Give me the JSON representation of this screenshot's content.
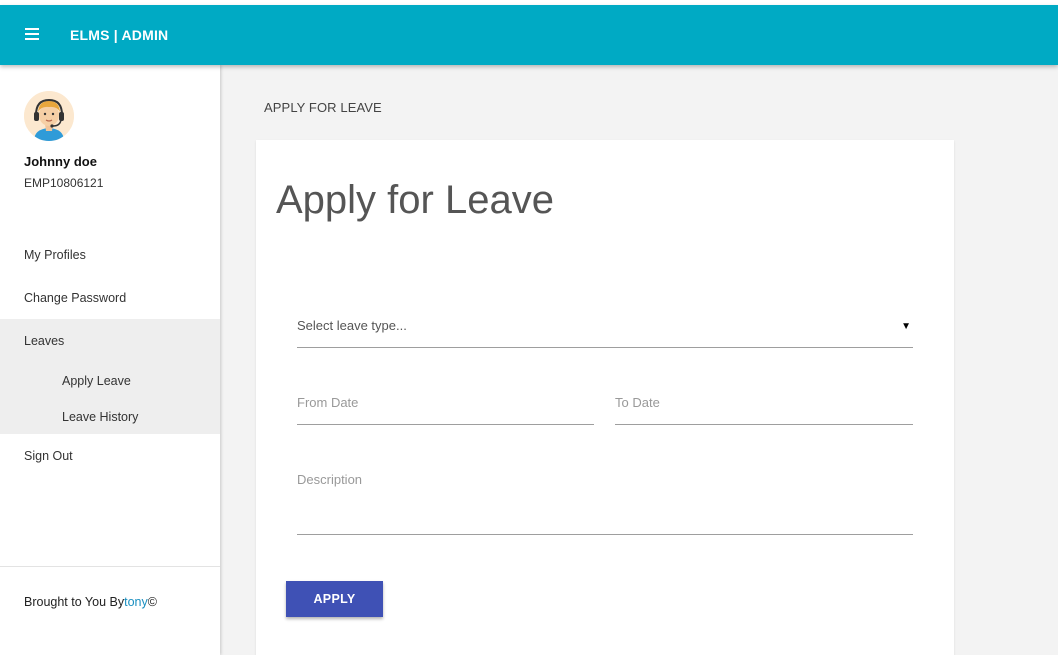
{
  "header": {
    "brand": "ELMS | ADMIN",
    "menu_icon": "hamburger-icon",
    "color": "#00aac4"
  },
  "user": {
    "name": "Johnny doe",
    "employee_id": "EMP10806121",
    "avatar_icon": "support-agent-avatar"
  },
  "sidebar": {
    "items": [
      {
        "label": "My Profiles"
      },
      {
        "label": "Change Password"
      },
      {
        "label": "Leaves",
        "children": [
          {
            "label": "Apply Leave"
          },
          {
            "label": "Leave History"
          }
        ]
      },
      {
        "label": "Sign Out"
      }
    ],
    "footer": {
      "prefix": "Brought to You By",
      "link": "tony",
      "suffix": "©"
    }
  },
  "breadcrumb": "APPLY FOR LEAVE",
  "form": {
    "title": "Apply for Leave",
    "leave_type_placeholder": "Select leave type...",
    "from_date_placeholder": "From Date",
    "to_date_placeholder": "To Date",
    "description_placeholder": "Description",
    "submit_label": "APPLY",
    "button_color": "#3f51b5"
  }
}
